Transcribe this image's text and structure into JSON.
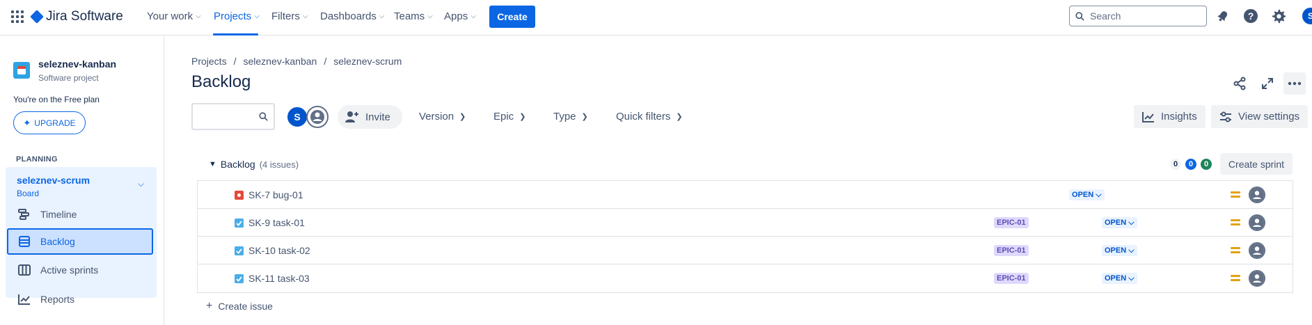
{
  "topnav": {
    "product_name": "Jira Software",
    "menu": [
      {
        "label": "Your work"
      },
      {
        "label": "Projects"
      },
      {
        "label": "Filters"
      },
      {
        "label": "Dashboards"
      },
      {
        "label": "Teams"
      },
      {
        "label": "Apps"
      }
    ],
    "create_label": "Create",
    "search_placeholder": "Search",
    "user_initial": "S",
    "accent": "#0c66e4"
  },
  "sidebar": {
    "project_name": "seleznev-kanban",
    "project_type": "Software project",
    "plan_note": "You're on the Free plan",
    "upgrade_label": "UPGRADE",
    "section_label": "PLANNING",
    "board_name": "seleznev-scrum",
    "board_type": "Board",
    "items": [
      {
        "label": "Timeline",
        "icon": "timeline-icon"
      },
      {
        "label": "Backlog",
        "icon": "backlog-icon",
        "active": true
      },
      {
        "label": "Active sprints",
        "icon": "board-columns-icon"
      },
      {
        "label": "Reports",
        "icon": "chart-line-icon"
      }
    ]
  },
  "main": {
    "breadcrumb": [
      "Projects",
      "seleznev-kanban",
      "seleznev-scrum"
    ],
    "title": "Backlog",
    "avatar_initial": "S",
    "invite_label": "Invite",
    "filters": [
      "Version",
      "Epic",
      "Type",
      "Quick filters"
    ],
    "insights_label": "Insights",
    "view_settings_label": "View settings",
    "backlog": {
      "label": "Backlog",
      "count_label": "(4 issues)",
      "badges": [
        "0",
        "0",
        "0"
      ],
      "create_sprint_label": "Create sprint",
      "issues": [
        {
          "key": "SK-7",
          "summary": "bug-01",
          "type": "bug",
          "epic": "",
          "status": "OPEN"
        },
        {
          "key": "SK-9",
          "summary": "task-01",
          "type": "task",
          "epic": "EPIC-01",
          "status": "OPEN"
        },
        {
          "key": "SK-10",
          "summary": "task-02",
          "type": "task",
          "epic": "EPIC-01",
          "status": "OPEN"
        },
        {
          "key": "SK-11",
          "summary": "task-03",
          "type": "task",
          "epic": "EPIC-01",
          "status": "OPEN"
        }
      ]
    },
    "create_issue_label": "Create issue"
  }
}
